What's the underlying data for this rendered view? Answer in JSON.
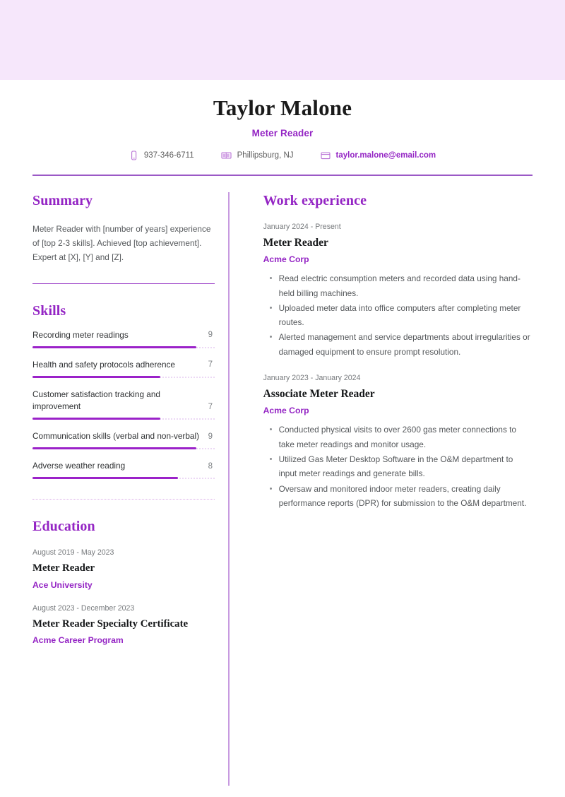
{
  "theme": {
    "banner_color": "#f6e7fb",
    "accent_color": "#9425c4",
    "bar_fill_color": "#9b22c9",
    "bar_track_color": "#ecd8f5",
    "divider_color": "#9b59c6",
    "body_text_color": "#55585b"
  },
  "header": {
    "name": "Taylor Malone",
    "title": "Meter Reader",
    "contacts": [
      {
        "icon": "phone-icon",
        "text": "937-346-6711",
        "is_link": false
      },
      {
        "icon": "map-icon",
        "text": "Phillipsburg, NJ",
        "is_link": false
      },
      {
        "icon": "envelope-icon",
        "text": "taylor.malone@email.com",
        "is_link": true
      }
    ]
  },
  "left": {
    "summary": {
      "heading": "Summary",
      "text": "Meter Reader with [number of years] experience of [top 2-3 skills]. Achieved [top achievement]. Expert at [X], [Y] and [Z]."
    },
    "skills": {
      "heading": "Skills",
      "max_score": 10,
      "items": [
        {
          "name": "Recording meter readings",
          "score": "9",
          "pct": 90
        },
        {
          "name": "Health and safety protocols adherence",
          "score": "7",
          "pct": 70
        },
        {
          "name": "Customer satisfaction tracking and improvement",
          "score": "7",
          "pct": 70
        },
        {
          "name": "Communication skills (verbal and non-verbal)",
          "score": "9",
          "pct": 90
        },
        {
          "name": "Adverse weather reading",
          "score": "8",
          "pct": 80
        }
      ]
    },
    "education": {
      "heading": "Education",
      "items": [
        {
          "date": "August 2019 - May 2023",
          "title": "Meter Reader",
          "org": "Ace University"
        },
        {
          "date": "August 2023 - December 2023",
          "title": "Meter Reader Specialty Certificate",
          "org": "Acme Career Program"
        }
      ]
    }
  },
  "right": {
    "work": {
      "heading": "Work experience",
      "jobs": [
        {
          "date": "January 2024 - Present",
          "title": "Meter Reader",
          "org": "Acme Corp",
          "bullets": [
            "Read electric consumption meters and recorded data using hand-held billing machines.",
            "Uploaded meter data into office computers after completing meter routes.",
            "Alerted management and service departments about irregularities or damaged equipment to ensure prompt resolution."
          ]
        },
        {
          "date": "January 2023 - January 2024",
          "title": "Associate Meter Reader",
          "org": "Acme Corp",
          "bullets": [
            "Conducted physical visits to over 2600 gas meter connections to take meter readings and monitor usage.",
            "Utilized Gas Meter Desktop Software in the O&M department to input meter readings and generate bills.",
            "Oversaw and monitored indoor meter readers, creating daily performance reports (DPR) for submission to the O&M department."
          ]
        }
      ]
    }
  }
}
